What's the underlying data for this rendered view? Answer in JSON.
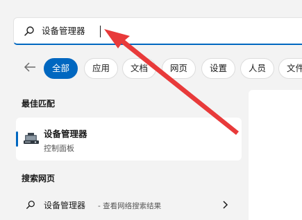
{
  "search": {
    "value": "设备管理器",
    "icon": "search-icon"
  },
  "filters": {
    "back_icon": "back-arrow-icon",
    "chips": [
      "全部",
      "应用",
      "文档",
      "网页",
      "设置",
      "人员",
      "文件"
    ],
    "active_index": 0
  },
  "best_match": {
    "section_label": "最佳匹配",
    "title": "设备管理器",
    "subtitle": "控制面板",
    "icon": "device-manager-icon"
  },
  "web_search": {
    "section_label": "搜索网页",
    "query": "设备管理器",
    "suffix": "- 查看网络搜索结果",
    "icon": "search-icon"
  },
  "colors": {
    "accent": "#0067c0",
    "annotation": "#e83a3a",
    "background": "#f3f3f3"
  }
}
